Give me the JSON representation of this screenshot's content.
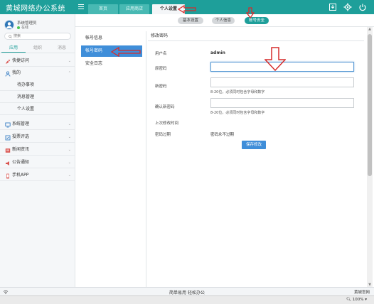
{
  "app": {
    "title": "黄城网络办公系统"
  },
  "top_tabs": [
    {
      "label": "首页"
    },
    {
      "label": "应用商店"
    },
    {
      "label": "个人设置"
    }
  ],
  "top_icons": [
    "download-icon",
    "gear-icon",
    "power-icon"
  ],
  "user": {
    "name": "系统管理员",
    "status": "在线"
  },
  "search": {
    "placeholder": "搜索"
  },
  "side_tabs": [
    {
      "label": "应用"
    },
    {
      "label": "组织"
    },
    {
      "label": "消息"
    }
  ],
  "menu": [
    {
      "label": "快捷访问",
      "icon": "rocket-icon",
      "color": "#d9534f"
    },
    {
      "label": "我的",
      "icon": "person-icon",
      "color": "#3a7fc4"
    },
    {
      "label": "待办事项"
    },
    {
      "label": "消息管理"
    },
    {
      "label": "个人设置"
    },
    {
      "label": "系统管理",
      "icon": "monitor-icon",
      "color": "#3a7fc4"
    },
    {
      "label": "投票评选",
      "icon": "vote-icon",
      "color": "#3a7fc4"
    },
    {
      "label": "新闻资讯",
      "icon": "news-icon",
      "color": "#d9534f"
    },
    {
      "label": "公告通知",
      "icon": "megaphone-icon",
      "color": "#d9534f"
    },
    {
      "label": "手机APP",
      "icon": "phone-icon",
      "color": "#d9534f"
    }
  ],
  "sub_tabs": [
    {
      "label": "基本设置"
    },
    {
      "label": "个人信息"
    },
    {
      "label": "账号安全"
    }
  ],
  "left_nav": [
    {
      "label": "帐号信息"
    },
    {
      "label": "帐号密码"
    },
    {
      "label": "安全日志"
    }
  ],
  "panel": {
    "title": "修改密码",
    "username_label": "用户名",
    "username_value": "admin",
    "old_password_label": "原密码",
    "old_password_value": "",
    "new_password_label": "新密码",
    "new_password_value": "",
    "new_password_hint": "8-20位，必须同时包含字母和数字",
    "confirm_label": "确认新密码",
    "confirm_value": "",
    "confirm_hint": "8-20位，必须同时包含字母和数字",
    "last_change_label": "上次修改时间",
    "last_change_value": "",
    "expire_label": "密码过期",
    "expire_value": "密码永不过期",
    "save_label": "保存修改"
  },
  "footer": {
    "center": "简单易用 轻松办公",
    "right": "黄城官网"
  },
  "statusbar": {
    "zoom": "100%"
  },
  "colors": {
    "primary": "#1e9f9a",
    "accent": "#3f8ed9",
    "annotation": "#d62b2b"
  }
}
